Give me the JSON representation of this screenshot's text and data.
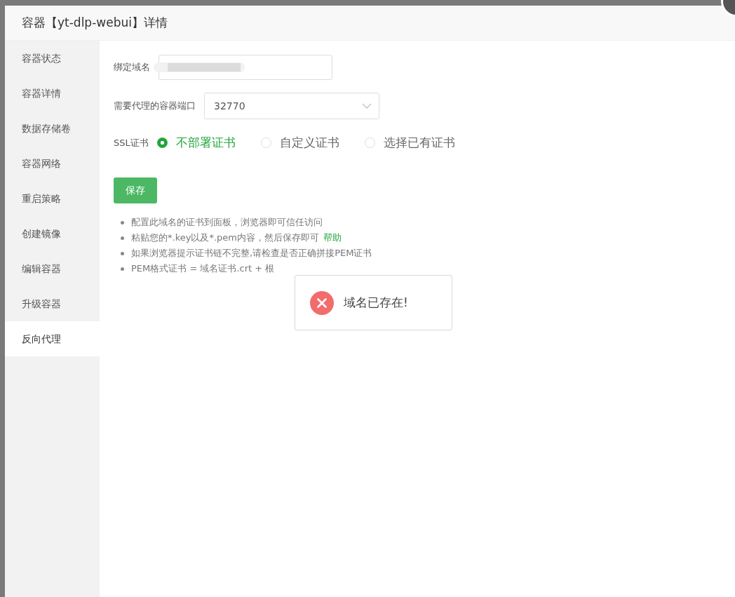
{
  "window": {
    "title": "容器【yt-dlp-webui】详情"
  },
  "sidebar": {
    "items": [
      {
        "label": "容器状态",
        "selected": false
      },
      {
        "label": "容器详情",
        "selected": false
      },
      {
        "label": "数据存储卷",
        "selected": false
      },
      {
        "label": "容器网络",
        "selected": false
      },
      {
        "label": "重启策略",
        "selected": false
      },
      {
        "label": "创建镜像",
        "selected": false
      },
      {
        "label": "编辑容器",
        "selected": false
      },
      {
        "label": "升级容器",
        "selected": false
      },
      {
        "label": "反向代理",
        "selected": true
      }
    ]
  },
  "form": {
    "domain": {
      "label": "绑定域名",
      "redacted": true
    },
    "port": {
      "label": "需要代理的容器端口",
      "value": "32770"
    },
    "ssl": {
      "label": "SSL证书",
      "options": [
        {
          "label": "不部署证书",
          "selected": true
        },
        {
          "label": "自定义证书",
          "selected": false
        },
        {
          "label": "选择已有证书",
          "selected": false
        }
      ]
    },
    "save_button": "保存"
  },
  "notes": [
    {
      "text": "配置此域名的证书到面板，浏览器即可信任访问"
    },
    {
      "text": "粘贴您的*.key以及*.pem内容，然后保存即可",
      "link": "帮助"
    },
    {
      "text": "如果浏览器提示证书链不完整,请检查是否正确拼接PEM证书"
    },
    {
      "text": "PEM格式证书 = 域名证书.crt + 根"
    }
  ],
  "toast": {
    "kind": "error",
    "message": "域名已存在!"
  }
}
